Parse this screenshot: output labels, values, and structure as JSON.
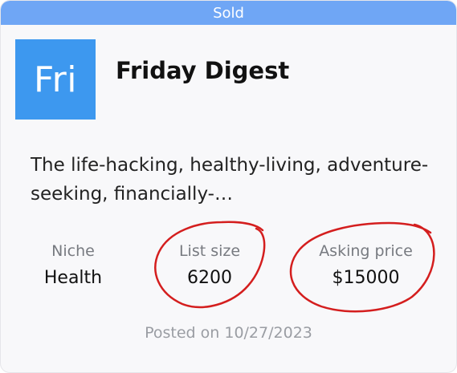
{
  "status_banner": "Sold",
  "newsletter": {
    "logo_text": "Fri",
    "logo_color": "#3d98ef",
    "title": "Friday Digest",
    "description": "The life-hacking, healthy-living, adventure-seeking, financially-…"
  },
  "stats": {
    "niche": {
      "label": "Niche",
      "value": "Health"
    },
    "list_size": {
      "label": "List size",
      "value": "6200"
    },
    "asking_price": {
      "label": "Asking price",
      "value": "$15000"
    }
  },
  "posted_text": "Posted on 10/27/2023",
  "colors": {
    "banner": "#6fa6f5",
    "annotation": "#d41e1e"
  }
}
